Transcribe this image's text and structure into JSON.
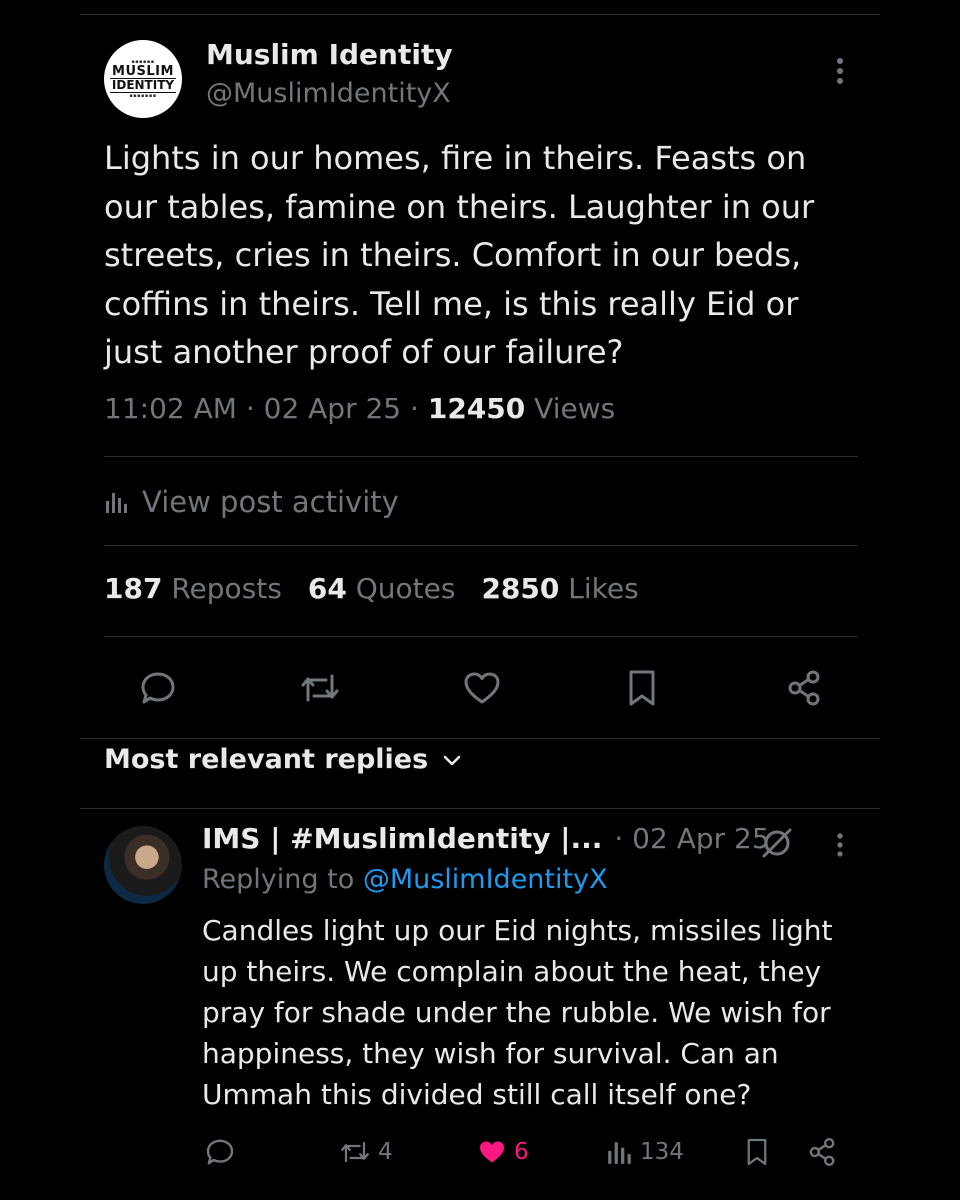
{
  "post": {
    "author_name": "Muslim Identity",
    "author_handle": "@MuslimIdentityX",
    "avatar_text_top": "MUSLIM",
    "avatar_text_bottom": "IDENTITY",
    "text": "Lights in our homes, fire in theirs. Feasts on our tables, famine on theirs. Laughter in our streets, cries in theirs. Comfort in our beds, coffins in theirs. Tell me, is this really Eid or just another proof of our failure?",
    "time": "11:02 AM",
    "date": "02 Apr 25",
    "views_count": "12450",
    "views_label": "Views",
    "separator": "·"
  },
  "activity": {
    "label": "View post activity",
    "icon": "bar-chart-icon"
  },
  "stats": [
    {
      "count": "187",
      "label": "Reposts"
    },
    {
      "count": "64",
      "label": "Quotes"
    },
    {
      "count": "2850",
      "label": "Likes"
    }
  ],
  "actions": [
    "reply-icon",
    "repost-icon",
    "like-icon",
    "bookmark-icon",
    "share-icon"
  ],
  "replies_sort": {
    "label": "Most relevant replies",
    "icon": "chevron-down-icon"
  },
  "reply": {
    "author_name": "IMS | #MuslimIdentity |...",
    "date": "· 02 Apr 25",
    "replying_prefix": "Replying to",
    "replying_handle": "@MuslimIdentityX",
    "text": "Candles light up our Eid nights, missiles light up theirs. We complain about the heat, they pray for shade under the rubble. We wish for happiness, they wish for survival. Can an Ummah this divided still call itself one?",
    "reposts": "4",
    "likes": "6",
    "views": "134"
  },
  "colors": {
    "background": "#000000",
    "text": "#e7e9ea",
    "secondary": "#71767b",
    "link": "#1d9bf0",
    "like_active": "#f91880",
    "divider": "#2a2d30"
  }
}
